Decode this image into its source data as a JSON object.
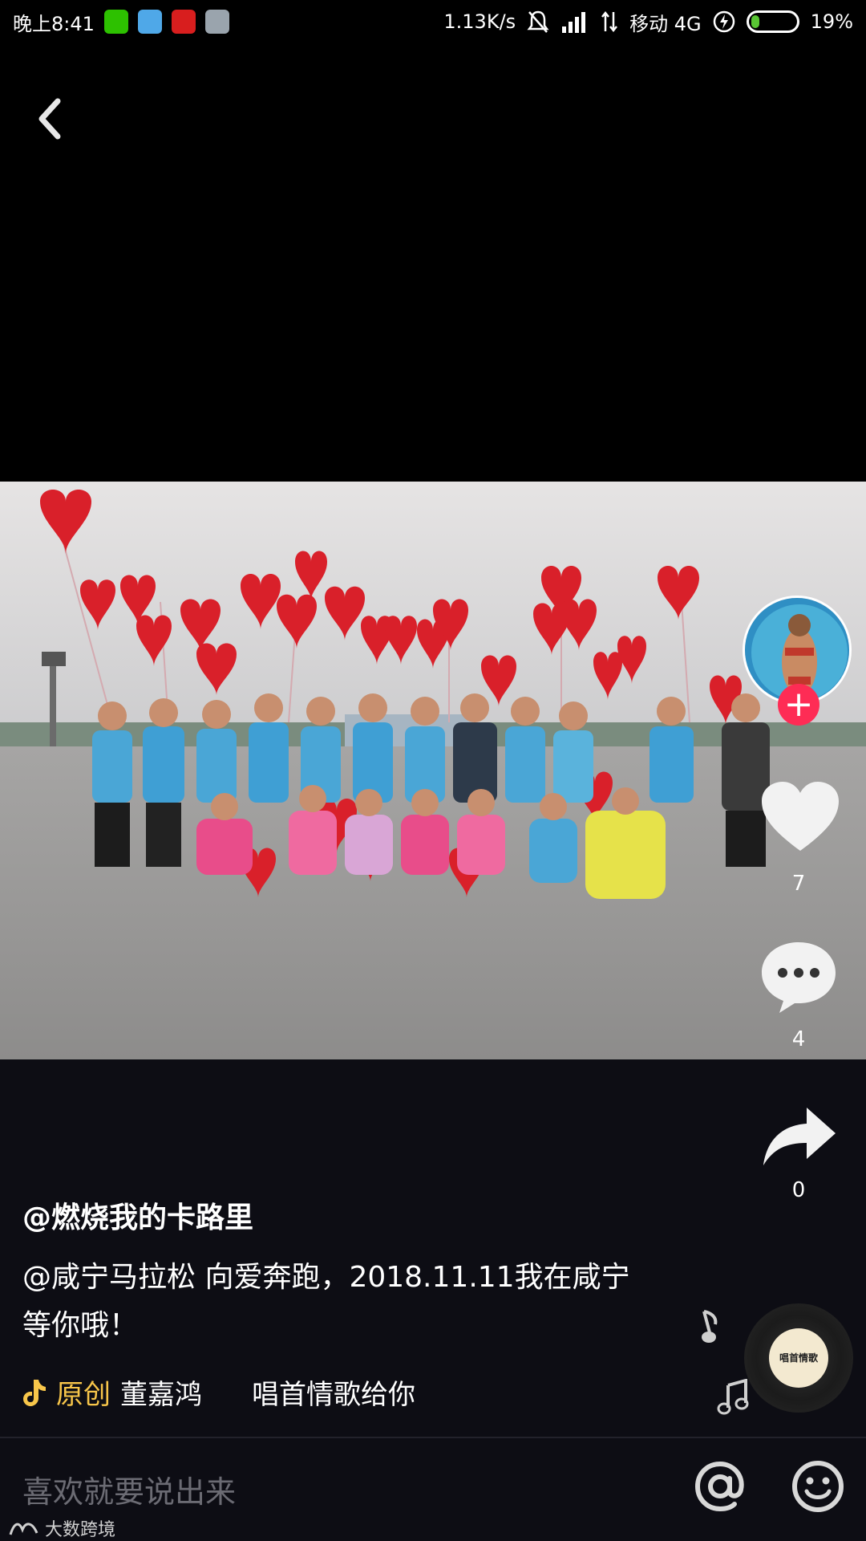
{
  "status_bar": {
    "time": "晚上8:41",
    "net_speed": "1.13K/s",
    "carrier": "移动 4G",
    "battery_percent": "19%",
    "battery_level": 0.19
  },
  "post": {
    "username": "@燃烧我的卡路里",
    "description": "@咸宁马拉松 向爱奔跑，2018.11.11我在咸宁等你哦！",
    "music_tag": "原创",
    "music_artist": "董嘉鸿",
    "music_title": "唱首情歌给你",
    "disc_label": "唱首情歌"
  },
  "actions": {
    "likes": "7",
    "comments": "4",
    "shares": "0"
  },
  "comment_bar": {
    "placeholder": "喜欢就要说出来"
  },
  "watermark": {
    "text": "大数跨境"
  },
  "colors": {
    "follow": "#fe2c55",
    "music_tag": "#f8c64a",
    "battery": "#58c633"
  }
}
